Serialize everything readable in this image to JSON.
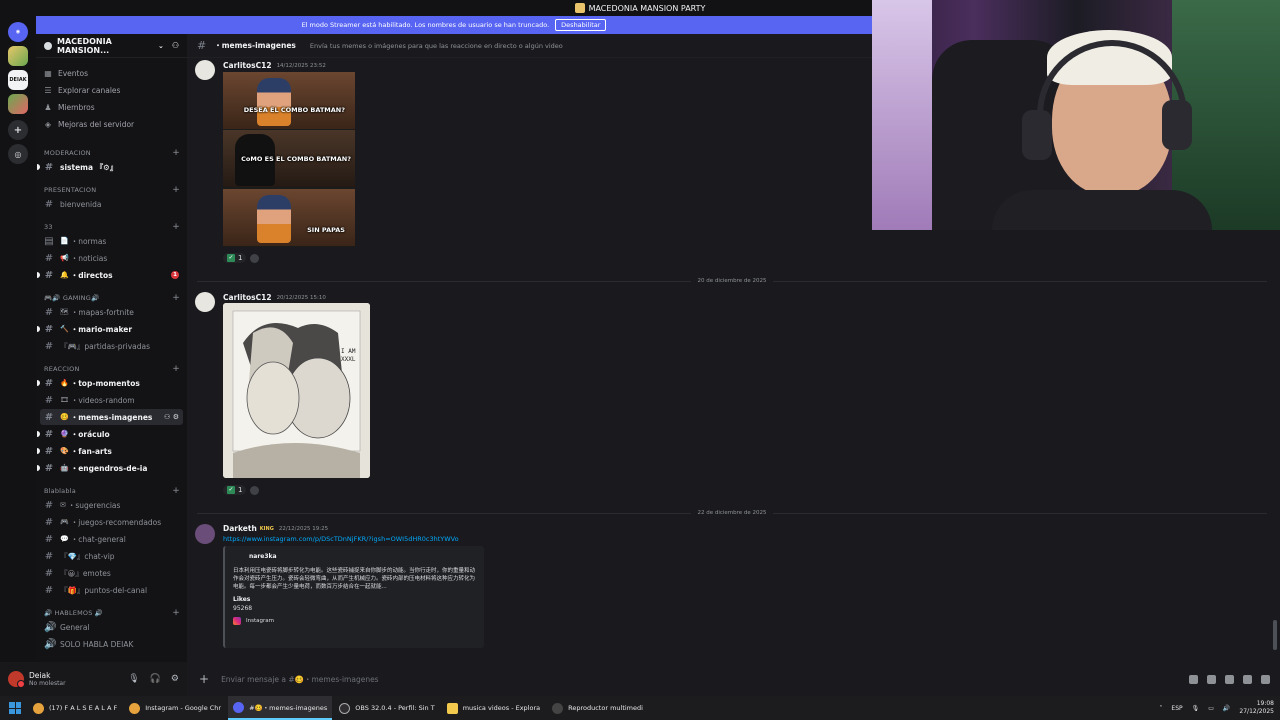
{
  "window": {
    "title": "MACEDONIA MANSION PARTY"
  },
  "banner": {
    "text": "El modo Streamer está habilitado. Los nombres de usuario se han truncado.",
    "button": "Deshabilitar"
  },
  "rail": {
    "items": [
      "discord-home",
      "server-1",
      "DEIAK",
      "server-3",
      "add-server",
      "explore"
    ],
    "deiak_label": "DEIAK"
  },
  "guild": {
    "name": "MACEDONIA MANSION...",
    "nav": [
      "Eventos",
      "Explorar canales",
      "Miembros",
      "Mejoras del servidor"
    ]
  },
  "categories": {
    "moderacion": "MODERACION",
    "presentacion": "PRESENTACION",
    "cat3": "33",
    "gaming": "🎮🔊 GAMING🔊",
    "reaccion": "REACCION",
    "blablabla": "Blablabla",
    "hablemos": "🔊 HABLEMOS 🔊"
  },
  "channels": {
    "sistema": "sistema 『⚙』",
    "bienvenida": "bienvenida",
    "normas": "・normas",
    "noticias": "・noticias",
    "directos": "・directos",
    "directos_badge": "1",
    "mapas": "・mapas-fortnite",
    "mario": "・mario-maker",
    "partidas": "『🎮』partidas-privadas",
    "top": "・top-momentos",
    "videos": "・videos-random",
    "memes": "・memes-imagenes",
    "oraculo": "・oráculo",
    "fanarts": "・fan-arts",
    "engendros": "・engendros-de-ia",
    "sugerencias": "・sugerencias",
    "juegos": "・juegos-recomendados",
    "chatgeneral": "・chat-general",
    "chatvip": "『💎』chat-vip",
    "emotes": "『😀』emotes",
    "puntos": "『🎁』puntos-del-canal",
    "general": "General",
    "solohabla": "SOLO HABLA DEIAK"
  },
  "user": {
    "name": "Deiak",
    "status": "No molestar"
  },
  "chat": {
    "channel": "・memes-imagenes",
    "topic": "Envía tus memes o imágenes para que las reaccione en directo o algún video",
    "messages": [
      {
        "author": "CarlitosC12",
        "time": "14/12/2025 23:52",
        "captions": [
          "DESEA EL COMBO BATMAN?",
          "CoMO ES EL COMBO BATMAN?",
          "SIN PAPAS"
        ],
        "reaction_count": "1"
      },
      {
        "author": "CarlitosC12",
        "time": "20/12/2025 15:10",
        "reaction_count": "1",
        "sketch_text": "I AM XXXL"
      },
      {
        "author": "Darketh",
        "tag": "KING",
        "time": "22/12/2025 19:25",
        "link": "https://www.instagram.com/p/DScTDnNjFKR/?igsh=OWI5dHR0c3htYWVo",
        "embed": {
          "author": "nare3ka",
          "description": "日本利用压电瓷砖将脚步转化为电能。这些瓷砖捕捉来自你脚步的动能。当你行走时，你的重量和动作会对瓷砖产生压力。瓷砖会轻微弯曲，从而产生机械应力。瓷砖内部的压电材料将这种应力转化为电能。每一步都会产生少量电荷，而数百万步结合在一起就能...",
          "field_label": "Likes",
          "field_value": "95268",
          "footer": "Instagram"
        }
      }
    ],
    "dividers": [
      "20 de diciembre de 2025",
      "22 de diciembre de 2025"
    ],
    "composer_placeholder": "Enviar mensaje a #🥴・memes-imagenes"
  },
  "taskbar": {
    "apps": [
      "(17) F A L S E A L A F",
      "Instagram - Google Chr",
      "#🥴・memes-imagenes",
      "OBS 32.0.4 - Perfil: Sin T",
      "musica videos - Explora",
      "Reproductor multimedi"
    ],
    "lang": "ESP",
    "time": "19:08",
    "date": "27/12/2025"
  },
  "colors": {
    "brand": "#5865f2",
    "link": "#00a8fc",
    "bg": "#1a1a1e",
    "sidebar": "#131316"
  }
}
